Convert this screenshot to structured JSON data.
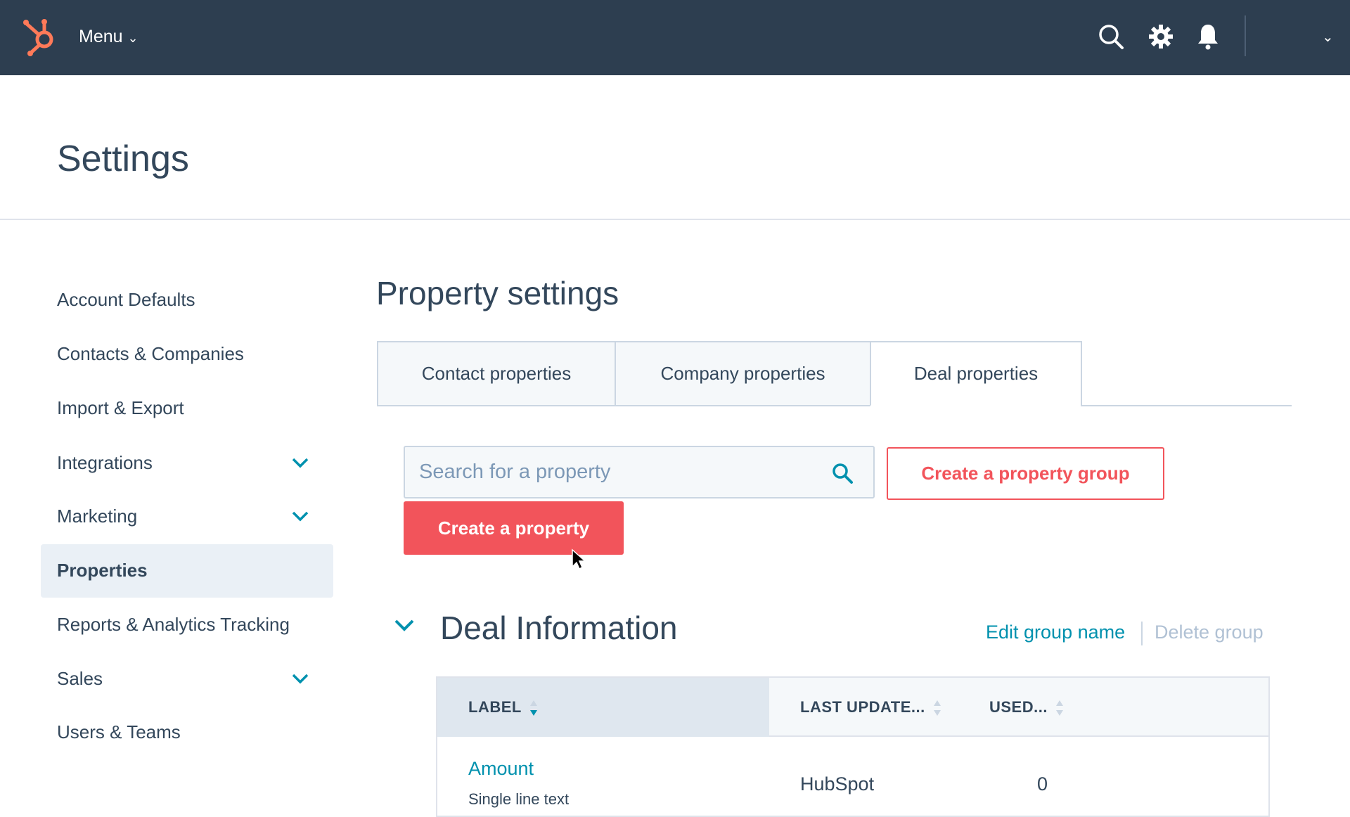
{
  "nav": {
    "menu_label": "Menu",
    "icons": [
      "hubspot-logo",
      "search-icon",
      "gear-icon",
      "bell-icon",
      "chevron-down-icon"
    ]
  },
  "page": {
    "title": "Settings"
  },
  "sidebar": {
    "items": [
      {
        "label": "Account Defaults"
      },
      {
        "label": "Contacts & Companies"
      },
      {
        "label": "Import & Export"
      },
      {
        "label": "Integrations",
        "expandable": true
      },
      {
        "label": "Marketing",
        "expandable": true
      },
      {
        "label": "Properties",
        "selected": true
      },
      {
        "label": "Reports & Analytics Tracking"
      },
      {
        "label": "Sales",
        "expandable": true
      },
      {
        "label": "Users & Teams"
      }
    ]
  },
  "main": {
    "title": "Property settings",
    "tabs": [
      {
        "label": "Contact properties"
      },
      {
        "label": "Company properties"
      },
      {
        "label": "Deal properties",
        "active": true
      }
    ],
    "search": {
      "placeholder": "Search for a property",
      "value": ""
    },
    "create_group_label": "Create a property group",
    "create_property_label": "Create a property",
    "group": {
      "title": "Deal Information",
      "edit_label": "Edit group name",
      "delete_label": "Delete group"
    },
    "table": {
      "columns": [
        "LABEL",
        "LAST UPDATE...",
        "USED..."
      ],
      "rows": [
        {
          "label": "Amount",
          "type": "Single line text",
          "last_updated": "HubSpot",
          "used": "0"
        }
      ]
    }
  },
  "colors": {
    "nav": "#2d3e50",
    "accent": "#f2545b",
    "link": "#0091ae",
    "text": "#33475b"
  }
}
